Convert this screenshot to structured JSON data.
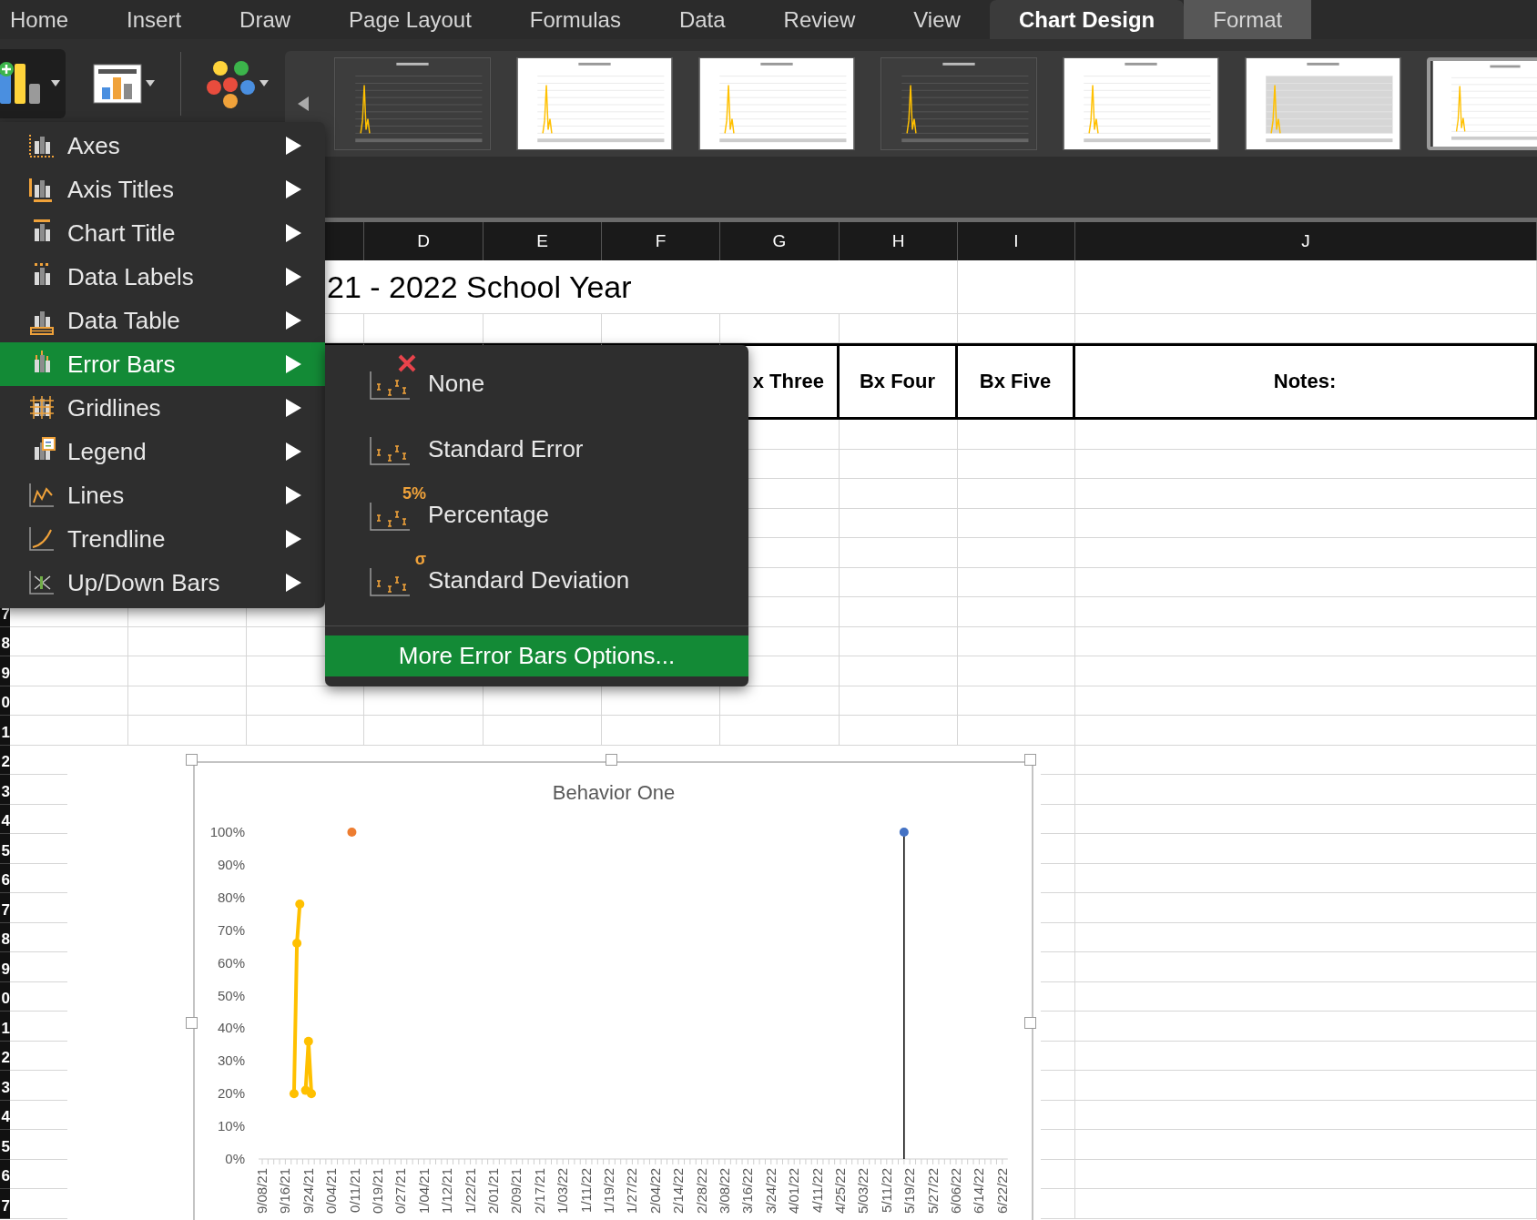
{
  "tabs": [
    {
      "label": "Home",
      "selected": false,
      "contextual": false
    },
    {
      "label": "Insert",
      "selected": false,
      "contextual": false
    },
    {
      "label": "Draw",
      "selected": false,
      "contextual": false
    },
    {
      "label": "Page Layout",
      "selected": false,
      "contextual": false
    },
    {
      "label": "Formulas",
      "selected": false,
      "contextual": false
    },
    {
      "label": "Data",
      "selected": false,
      "contextual": false
    },
    {
      "label": "Review",
      "selected": false,
      "contextual": false
    },
    {
      "label": "View",
      "selected": false,
      "contextual": false
    },
    {
      "label": "Chart Design",
      "selected": true,
      "contextual": true
    },
    {
      "label": "Format",
      "selected": false,
      "contextual": true
    }
  ],
  "ribbon": {
    "chart_styles": [
      {
        "dark": true,
        "shaded": false,
        "selected": false
      },
      {
        "dark": false,
        "shaded": false,
        "selected": false
      },
      {
        "dark": false,
        "shaded": false,
        "selected": false
      },
      {
        "dark": true,
        "shaded": false,
        "selected": false
      },
      {
        "dark": false,
        "shaded": false,
        "selected": false
      },
      {
        "dark": false,
        "shaded": true,
        "selected": false
      },
      {
        "dark": false,
        "shaded": false,
        "selected": true
      }
    ]
  },
  "columns": [
    "D",
    "E",
    "F",
    "G",
    "H",
    "I",
    "J"
  ],
  "sheet": {
    "title": "21 - 2022 School Year",
    "headers": [
      "x Three",
      "Bx Four",
      "Bx Five",
      "Notes:"
    ],
    "row_numbers": [
      "7",
      "8",
      "9",
      "0",
      "1",
      "2",
      "3",
      "4",
      "5",
      "6",
      "7",
      "8",
      "9",
      "0",
      "1",
      "2",
      "3",
      "4",
      "5",
      "6",
      "7"
    ]
  },
  "menu": {
    "items": [
      {
        "label": "Axes",
        "selected": false
      },
      {
        "label": "Axis Titles",
        "selected": false
      },
      {
        "label": "Chart Title",
        "selected": false
      },
      {
        "label": "Data Labels",
        "selected": false
      },
      {
        "label": "Data Table",
        "selected": false
      },
      {
        "label": "Error Bars",
        "selected": true
      },
      {
        "label": "Gridlines",
        "selected": false
      },
      {
        "label": "Legend",
        "selected": false
      },
      {
        "label": "Lines",
        "selected": false
      },
      {
        "label": "Trendline",
        "selected": false
      },
      {
        "label": "Up/Down Bars",
        "selected": false
      }
    ]
  },
  "submenu": {
    "items": [
      {
        "label": "None",
        "kind": "none"
      },
      {
        "label": "Standard Error",
        "kind": "plain"
      },
      {
        "label": "Percentage",
        "kind": "badge",
        "icon_text": "5%"
      },
      {
        "label": "Standard Deviation",
        "kind": "badge",
        "icon_text": "σ"
      }
    ],
    "more_options": "More Error Bars Options..."
  },
  "chart": {
    "chart_data": {
      "type": "line",
      "title": "Behavior One",
      "categories": [
        "9/08/21",
        null,
        null,
        null,
        null,
        null,
        null,
        null,
        "9/16/21",
        null,
        null,
        null,
        null,
        null,
        null,
        null,
        "9/24/21",
        null,
        null,
        null,
        null,
        null,
        null,
        null,
        "0/04/21",
        null,
        null,
        null,
        null,
        null,
        null,
        null,
        "0/11/21",
        null,
        null,
        null,
        null,
        null,
        null,
        null,
        "0/19/21",
        null,
        null,
        null,
        null,
        null,
        null,
        null,
        "0/27/21",
        null,
        null,
        null,
        null,
        null,
        null,
        null,
        "1/04/21",
        null,
        null,
        null,
        null,
        null,
        null,
        null,
        "1/12/21",
        null,
        null,
        null,
        null,
        null,
        null,
        null,
        "1/22/21",
        null,
        null,
        null,
        null,
        null,
        null,
        null,
        "2/01/21",
        null,
        null,
        null,
        null,
        null,
        null,
        null,
        "2/09/21",
        null,
        null,
        null,
        null,
        null,
        null,
        null,
        "2/17/21",
        null,
        null,
        null,
        null,
        null,
        null,
        null,
        "1/03/22",
        null,
        null,
        null,
        null,
        null,
        null,
        null,
        "1/11/22",
        null,
        null,
        null,
        null,
        null,
        null,
        null,
        "1/19/22",
        null,
        null,
        null,
        null,
        null,
        null,
        null,
        "1/27/22",
        null,
        null,
        null,
        null,
        null,
        null,
        null,
        "2/04/22",
        null,
        null,
        null,
        null,
        null,
        null,
        null,
        "2/14/22",
        null,
        null,
        null,
        null,
        null,
        null,
        null,
        "2/28/22",
        null,
        null,
        null,
        null,
        null,
        null,
        null,
        "3/08/22",
        null,
        null,
        null,
        null,
        null,
        null,
        null,
        "3/16/22",
        null,
        null,
        null,
        null,
        null,
        null,
        null,
        "3/24/22",
        null,
        null,
        null,
        null,
        null,
        null,
        null,
        "4/01/22",
        null,
        null,
        null,
        null,
        null,
        null,
        null,
        "4/11/22",
        null,
        null,
        null,
        null,
        null,
        null,
        null,
        "4/25/22",
        null,
        null,
        null,
        null,
        null,
        null,
        null,
        "5/03/22",
        null,
        null,
        null,
        null,
        null,
        null,
        null,
        "5/11/22",
        null,
        null,
        null,
        null,
        null,
        null,
        null,
        "5/19/22",
        null,
        null,
        null,
        null,
        null,
        null,
        null,
        "5/27/22",
        null,
        null,
        null,
        null,
        null,
        null,
        null,
        "6/06/22",
        null,
        null,
        null,
        null,
        null,
        null,
        null,
        "6/14/22",
        null,
        null,
        null,
        null,
        null,
        null,
        null,
        "6/22/22"
      ],
      "ylim": [
        0,
        1
      ],
      "yticks": [
        {
          "value": 0,
          "label": "0%"
        },
        {
          "value": 0.1,
          "label": "10%"
        },
        {
          "value": 0.2,
          "label": "20%"
        },
        {
          "value": 0.3,
          "label": "30%"
        },
        {
          "value": 0.4,
          "label": "40%"
        },
        {
          "value": 0.5,
          "label": "50%"
        },
        {
          "value": 0.6,
          "label": "60%"
        },
        {
          "value": 0.7,
          "label": "70%"
        },
        {
          "value": 0.8,
          "label": "80%"
        },
        {
          "value": 0.9,
          "label": "90%"
        },
        {
          "value": 1,
          "label": "100%"
        }
      ],
      "series": [
        {
          "color": "#ffc000",
          "marker": "circle",
          "values": [
            null,
            null,
            null,
            null,
            null,
            null,
            null,
            null,
            null,
            null,
            null,
            0.2,
            0.66,
            0.78,
            null,
            0.21,
            0.36,
            0.2,
            null,
            null,
            null,
            null,
            null,
            null,
            null,
            null,
            null,
            null,
            null,
            null,
            null,
            null,
            null,
            null,
            null,
            null,
            null,
            null,
            null,
            null,
            null,
            null,
            null,
            null,
            null,
            null,
            null,
            null,
            null,
            null,
            null,
            null,
            null,
            null,
            null,
            null,
            null,
            null,
            null,
            null,
            null,
            null,
            null,
            null,
            null,
            null,
            null,
            null,
            null,
            null,
            null,
            null,
            null,
            null,
            null,
            null,
            null,
            null,
            null,
            null,
            null,
            null,
            null,
            null,
            null,
            null,
            null,
            null,
            null,
            null,
            null,
            null,
            null,
            null,
            null,
            null,
            null,
            null,
            null,
            null,
            null,
            null,
            null,
            null,
            null,
            null,
            null,
            null,
            null,
            null,
            null,
            null,
            null,
            null,
            null,
            null,
            null,
            null,
            null,
            null,
            null,
            null,
            null,
            null,
            null,
            null,
            null,
            null,
            null,
            null,
            null,
            null,
            null,
            null,
            null,
            null,
            null,
            null,
            null,
            null,
            null,
            null,
            null,
            null,
            null,
            null,
            null,
            null,
            null,
            null,
            null,
            null,
            null,
            null,
            null,
            null,
            null,
            null,
            null,
            null,
            null,
            null,
            null,
            null,
            null,
            null,
            null,
            null,
            null,
            null,
            null,
            null,
            null,
            null,
            null,
            null,
            null,
            null,
            null,
            null,
            null,
            null,
            null,
            null,
            null,
            null,
            null,
            null,
            null,
            null,
            null,
            null,
            null,
            null,
            null,
            null,
            null,
            null,
            null,
            null,
            null,
            null,
            null,
            null,
            null,
            null,
            null,
            null,
            null,
            null,
            null,
            null,
            null,
            null,
            null,
            null,
            null,
            null,
            null,
            null,
            null,
            null,
            null,
            null,
            null,
            null,
            null,
            null,
            null,
            null,
            null,
            null,
            null,
            null,
            null,
            null,
            null,
            null,
            null,
            null,
            null,
            null,
            null,
            null,
            null,
            null,
            null,
            null,
            null,
            null,
            null,
            null,
            null,
            null,
            null,
            null,
            null
          ]
        },
        {
          "color": "#ed7d31",
          "marker": "circle",
          "values": [
            null,
            null,
            null,
            null,
            null,
            null,
            null,
            null,
            null,
            null,
            null,
            null,
            null,
            null,
            null,
            null,
            null,
            null,
            null,
            null,
            null,
            null,
            null,
            null,
            null,
            null,
            null,
            null,
            null,
            null,
            null,
            1.0,
            null,
            null,
            null,
            null,
            null,
            null,
            null,
            null,
            null,
            null,
            null,
            null,
            null,
            null,
            null,
            null,
            null,
            null,
            null,
            null,
            null,
            null,
            null,
            null,
            null,
            null,
            null,
            null,
            null,
            null,
            null,
            null,
            null,
            null,
            null,
            null,
            null,
            null,
            null,
            null,
            null,
            null,
            null,
            null,
            null,
            null,
            null,
            null,
            null,
            null,
            null,
            null,
            null,
            null,
            null,
            null,
            null,
            null,
            null,
            null,
            null,
            null,
            null,
            null,
            null,
            null,
            null,
            null,
            null,
            null,
            null,
            null,
            null,
            null,
            null,
            null,
            null,
            null,
            null,
            null,
            null,
            null,
            null,
            null,
            null,
            null,
            null,
            null,
            null,
            null,
            null,
            null,
            null,
            null,
            null,
            null,
            null,
            null,
            null,
            null,
            null,
            null,
            null,
            null,
            null,
            null,
            null,
            null,
            null,
            null,
            null,
            null,
            null,
            null,
            null,
            null,
            null,
            null,
            null,
            null,
            null,
            null,
            null,
            null,
            null,
            null,
            null,
            null,
            null,
            null,
            null,
            null,
            null,
            null,
            null,
            null,
            null,
            null,
            null,
            null,
            null,
            null,
            null,
            null,
            null,
            null,
            null,
            null,
            null,
            null,
            null,
            null,
            null,
            null,
            null,
            null,
            null,
            null,
            null,
            null,
            null,
            null,
            null,
            null,
            null,
            null,
            null,
            null,
            null,
            null,
            null,
            null,
            null,
            null,
            null,
            null,
            null,
            null,
            null,
            null,
            null,
            null,
            null,
            null,
            null,
            null,
            null,
            null,
            null,
            null,
            null,
            null,
            null,
            null,
            null,
            null,
            null,
            null,
            null,
            null,
            null,
            null,
            null,
            null,
            null,
            null,
            null,
            null,
            null,
            null,
            null,
            null,
            null,
            null,
            null,
            null,
            null,
            null,
            null,
            null,
            null,
            null,
            null,
            null,
            null
          ]
        },
        {
          "color": "#4472c4",
          "marker": "circle",
          "values": [
            null,
            null,
            null,
            null,
            null,
            null,
            null,
            null,
            null,
            null,
            null,
            null,
            null,
            null,
            null,
            null,
            null,
            null,
            null,
            null,
            null,
            null,
            null,
            null,
            null,
            null,
            null,
            null,
            null,
            null,
            null,
            null,
            null,
            null,
            null,
            null,
            null,
            null,
            null,
            null,
            null,
            null,
            null,
            null,
            null,
            null,
            null,
            null,
            null,
            null,
            null,
            null,
            null,
            null,
            null,
            null,
            null,
            null,
            null,
            null,
            null,
            null,
            null,
            null,
            null,
            null,
            null,
            null,
            null,
            null,
            null,
            null,
            null,
            null,
            null,
            null,
            null,
            null,
            null,
            null,
            null,
            null,
            null,
            null,
            null,
            null,
            null,
            null,
            null,
            null,
            null,
            null,
            null,
            null,
            null,
            null,
            null,
            null,
            null,
            null,
            null,
            null,
            null,
            null,
            null,
            null,
            null,
            null,
            null,
            null,
            null,
            null,
            null,
            null,
            null,
            null,
            null,
            null,
            null,
            null,
            null,
            null,
            null,
            null,
            null,
            null,
            null,
            null,
            null,
            null,
            null,
            null,
            null,
            null,
            null,
            null,
            null,
            null,
            null,
            null,
            null,
            null,
            null,
            null,
            null,
            null,
            null,
            null,
            null,
            null,
            null,
            null,
            null,
            null,
            null,
            null,
            null,
            null,
            null,
            null,
            null,
            null,
            null,
            null,
            null,
            null,
            null,
            null,
            null,
            null,
            null,
            null,
            null,
            null,
            null,
            null,
            null,
            null,
            null,
            null,
            null,
            null,
            null,
            null,
            null,
            null,
            null,
            null,
            null,
            null,
            null,
            null,
            null,
            null,
            null,
            null,
            null,
            null,
            null,
            null,
            null,
            null,
            null,
            null,
            null,
            null,
            null,
            null,
            null,
            null,
            null,
            null,
            null,
            null,
            null,
            null,
            null,
            null,
            null,
            null,
            null,
            null,
            1.0,
            null,
            null,
            null,
            null,
            null,
            null,
            null,
            null,
            null,
            null,
            null,
            null,
            null,
            null,
            null,
            null,
            null,
            null,
            null,
            null,
            null,
            null,
            null,
            null,
            null,
            null,
            null,
            null,
            null,
            null,
            null,
            null,
            null,
            null
          ]
        }
      ]
    }
  }
}
